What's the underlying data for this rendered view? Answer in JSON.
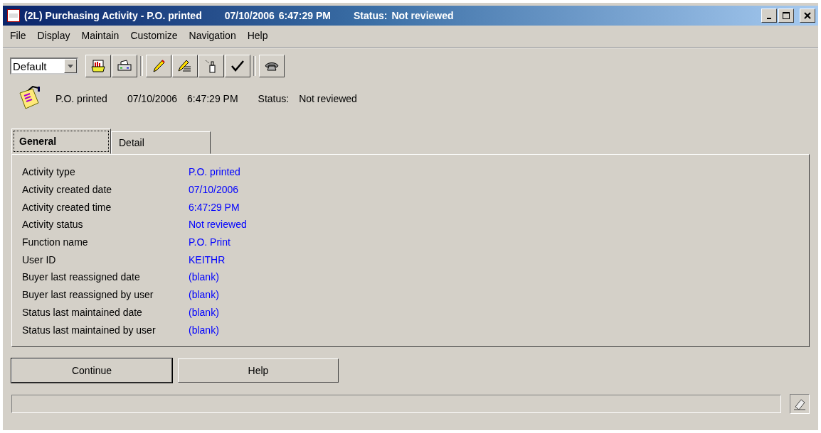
{
  "window": {
    "title": "(2L) Purchasing Activity - P.O. printed",
    "title_date": "07/10/2006",
    "title_time": "6:47:29 PM",
    "title_status_label": "Status:",
    "title_status": "Not reviewed"
  },
  "menu": [
    "File",
    "Display",
    "Maintain",
    "Customize",
    "Navigation",
    "Help"
  ],
  "toolbar": {
    "view_select": "Default"
  },
  "header": {
    "activity": "P.O. printed",
    "date": "07/10/2006",
    "time": "6:47:29 PM",
    "status_label": "Status:",
    "status": "Not reviewed"
  },
  "tabs": [
    {
      "label": "General",
      "selected": true
    },
    {
      "label": "Detail",
      "selected": false
    }
  ],
  "fields": [
    {
      "label": "Activity type",
      "value": "P.O. printed"
    },
    {
      "label": "Activity created date",
      "value": "07/10/2006"
    },
    {
      "label": "Activity created time",
      "value": "6:47:29 PM"
    },
    {
      "label": "Activity status",
      "value": "Not reviewed"
    },
    {
      "label": "Function name",
      "value": "P.O. Print"
    },
    {
      "label": "User ID",
      "value": "KEITHR"
    },
    {
      "label": "Buyer last reassigned date",
      "value": "(blank)"
    },
    {
      "label": "Buyer last reassigned by user",
      "value": "(blank)"
    },
    {
      "label": "Status last maintained date",
      "value": "(blank)"
    },
    {
      "label": "Status last maintained by user",
      "value": "(blank)"
    }
  ],
  "buttons": [
    {
      "label": "Continue",
      "selected": true
    },
    {
      "label": "Help",
      "selected": false
    }
  ]
}
